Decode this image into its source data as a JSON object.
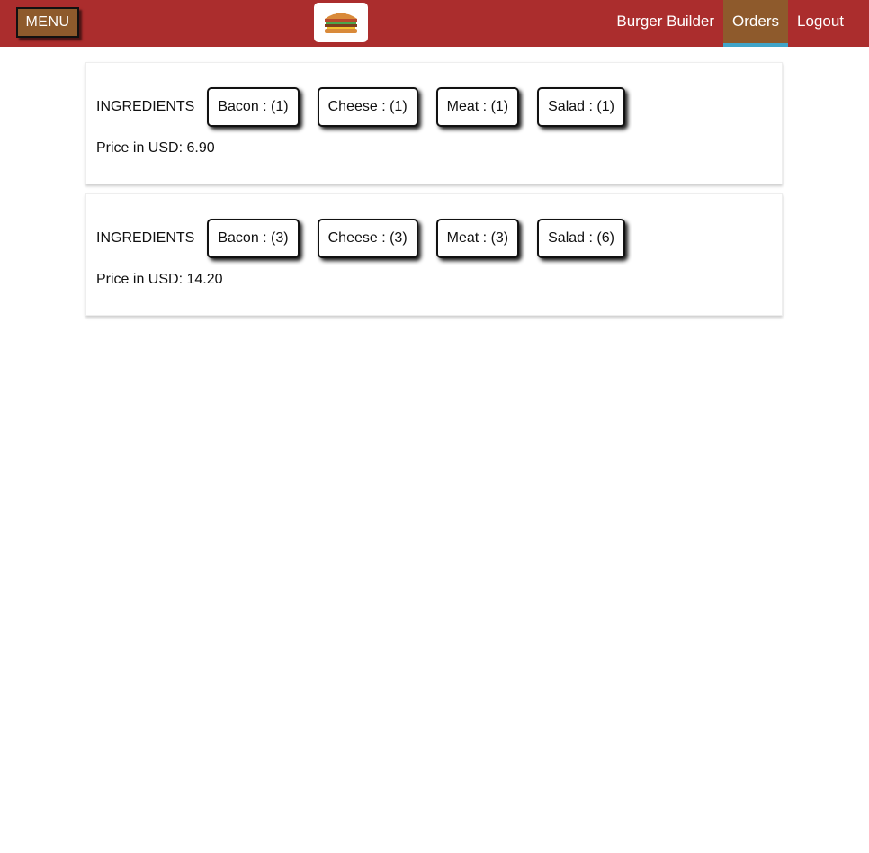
{
  "header": {
    "menu_label": "MENU",
    "logo_icon": "burger-logo-icon",
    "nav": [
      {
        "label": "Burger Builder",
        "active": false
      },
      {
        "label": "Orders",
        "active": true
      },
      {
        "label": "Logout",
        "active": false
      }
    ],
    "colors": {
      "toolbar": "#ab2d2d",
      "menu_button": "#8e5a2c",
      "active_nav": "#8e5a2c",
      "active_underline": "#40a4c8"
    }
  },
  "orders": [
    {
      "ingredients_label": "INGREDIENTS",
      "ingredients": [
        {
          "text": "Bacon : (1)"
        },
        {
          "text": "Cheese : (1)"
        },
        {
          "text": "Meat : (1)"
        },
        {
          "text": "Salad : (1)"
        }
      ],
      "price_text": "Price in USD: 6.90"
    },
    {
      "ingredients_label": "INGREDIENTS",
      "ingredients": [
        {
          "text": "Bacon : (3)"
        },
        {
          "text": "Cheese : (3)"
        },
        {
          "text": "Meat : (3)"
        },
        {
          "text": "Salad : (6)"
        }
      ],
      "price_text": "Price in USD: 14.20"
    }
  ]
}
